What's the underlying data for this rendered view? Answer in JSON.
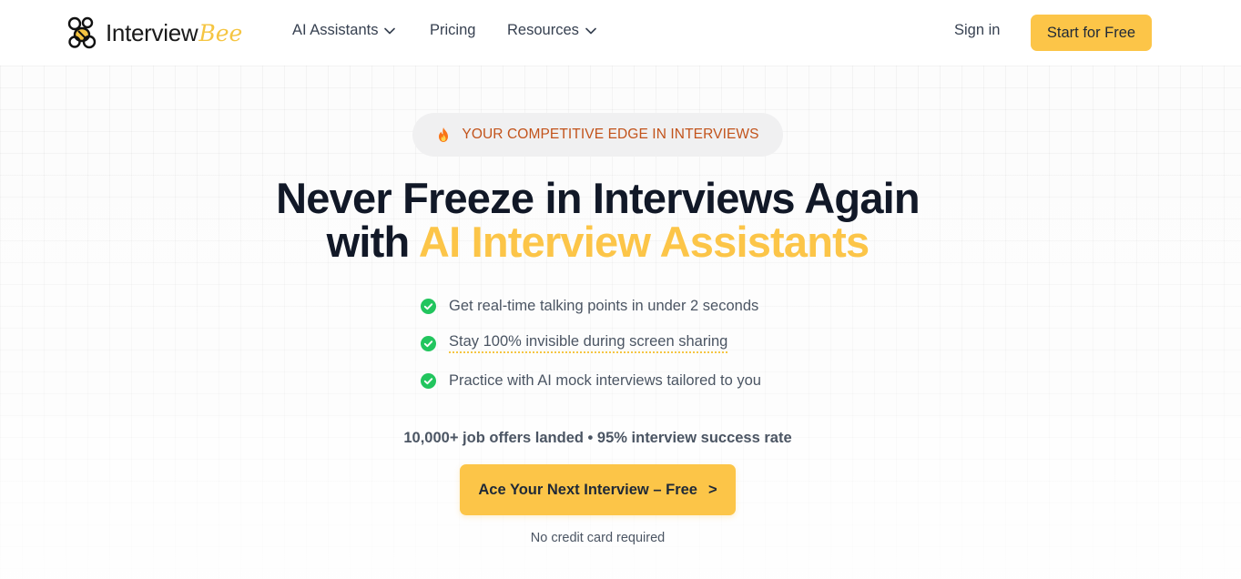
{
  "brand": {
    "name": "Interview",
    "accent": "Bee",
    "logo_icon": "bee-icon",
    "accent_color": "#fcc548"
  },
  "nav": {
    "items": [
      {
        "label": "AI Assistants",
        "has_dropdown": true,
        "icon": "chevron-down-icon"
      },
      {
        "label": "Pricing",
        "has_dropdown": false
      },
      {
        "label": "Resources",
        "has_dropdown": true,
        "icon": "chevron-down-icon"
      }
    ],
    "sign_in": "Sign in",
    "cta": "Start for Free"
  },
  "hero": {
    "badge": {
      "icon": "flame-icon",
      "text": "YOUR COMPETITIVE EDGE IN INTERVIEWS"
    },
    "headline_line1": "Never Freeze in Interviews Again",
    "headline_line2_prefix": "with ",
    "headline_line2_accent": "AI Interview Assistants",
    "features": [
      {
        "icon": "check-circle-icon",
        "text": "Get real-time talking points in under 2 seconds"
      },
      {
        "icon": "check-circle-icon",
        "text": "Stay 100% invisible during screen sharing"
      },
      {
        "icon": "check-circle-icon",
        "text": "Practice with AI mock interviews tailored to you"
      }
    ],
    "stats": "10,000+ job offers landed • 95% interview success rate",
    "cta_label": "Ace Your Next Interview – Free",
    "cta_arrow": ">",
    "note": "No credit card required"
  },
  "colors": {
    "check": "#22c55e",
    "badge_text": "#c2531b",
    "button": "#fcc548"
  }
}
